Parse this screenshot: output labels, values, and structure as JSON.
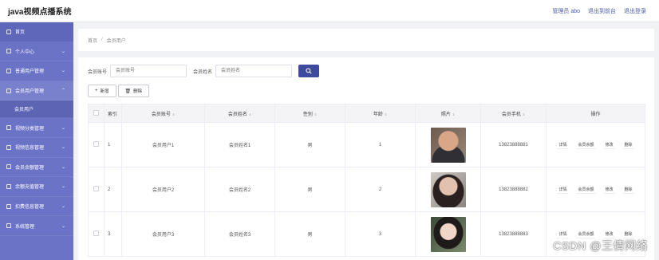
{
  "app": {
    "title": "java视频点播系统"
  },
  "topbar": {
    "admin_label": "管理员 abo",
    "front_link": "退出到前台",
    "logout_link": "退出登录"
  },
  "sidebar": {
    "items": [
      {
        "label": "首页",
        "icon": "home-icon"
      },
      {
        "label": "个人中心",
        "icon": "person-icon"
      },
      {
        "label": "普通用户管理",
        "icon": "grid-icon"
      },
      {
        "label": "会员用户管理",
        "icon": "user-icon",
        "expanded": true
      },
      {
        "label": "会员用户",
        "sub": true
      },
      {
        "label": "视频分类管理",
        "icon": "list-icon"
      },
      {
        "label": "视频信息管理",
        "icon": "list-icon"
      },
      {
        "label": "会员余额管理",
        "icon": "wallet-icon"
      },
      {
        "label": "余额充值管理",
        "icon": "wallet-icon"
      },
      {
        "label": "扣费信息管理",
        "icon": "money-icon"
      },
      {
        "label": "系统管理",
        "icon": "settings-icon"
      }
    ]
  },
  "breadcrumb": {
    "home": "首页",
    "sep": "/",
    "current": "会员用户"
  },
  "search": {
    "account_label": "会员账号",
    "account_placeholder": "会员账号",
    "name_label": "会员姓名",
    "name_placeholder": "会员姓名"
  },
  "actions": {
    "add_label": "新增",
    "add_glyph": "+",
    "delete_label": "删除",
    "delete_glyph": "🗑"
  },
  "table": {
    "columns": [
      "索引",
      "会员账号",
      "会员姓名",
      "性别",
      "年龄",
      "照片",
      "会员手机",
      "操作"
    ],
    "rows": [
      {
        "index": "1",
        "account": "会员用户1",
        "name": "会员姓名1",
        "gender": "男",
        "age": "1",
        "phone": "13823888881"
      },
      {
        "index": "2",
        "account": "会员用户2",
        "name": "会员姓名2",
        "gender": "男",
        "age": "2",
        "phone": "13823888882"
      },
      {
        "index": "3",
        "account": "会员用户3",
        "name": "会员姓名3",
        "gender": "男",
        "age": "3",
        "phone": "13823888883"
      }
    ],
    "row_ops": [
      "详情",
      "会员余额",
      "修改",
      "删除"
    ]
  },
  "watermark": "CSDN @王倩网络",
  "colors": {
    "sidebar": "#6b73c6",
    "accent": "#3f4a9e",
    "top_link": "#4b5aa6"
  }
}
